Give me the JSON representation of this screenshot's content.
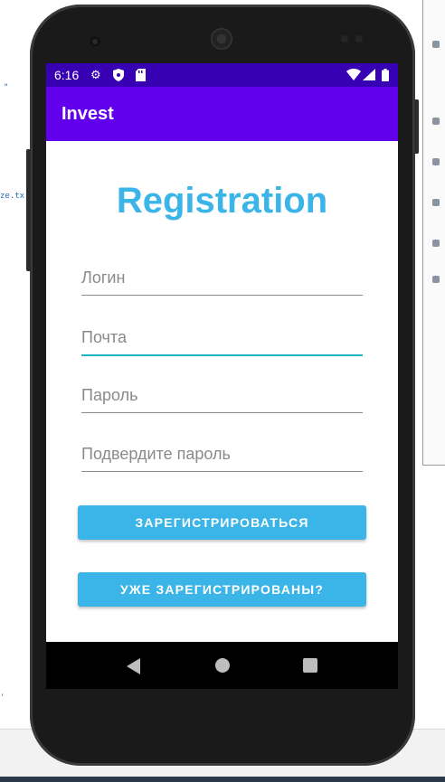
{
  "ide": {
    "snippet1": "\"",
    "snippet2": "ze.tx",
    "snippet3": "'"
  },
  "status_bar": {
    "time": "6:16",
    "icons": [
      "settings-icon",
      "shield-icon",
      "sd-card-icon",
      "wifi-icon",
      "signal-icon",
      "battery-icon"
    ]
  },
  "app_bar": {
    "title": "Invest"
  },
  "form": {
    "title": "Registration",
    "login_placeholder": "Логин",
    "email_placeholder": "Почта",
    "password_placeholder": "Пароль",
    "confirm_placeholder": "Подвердите пароль",
    "register_label": "ЗАРЕГИСТРИРОВАТЬСЯ",
    "already_label": "УЖЕ ЗАРЕГИСТРИРОВАНЫ?"
  },
  "nav": {
    "icons": [
      "back-icon",
      "home-icon",
      "recents-icon"
    ]
  },
  "colors": {
    "status_bar": "#3700b3",
    "app_bar": "#6200ee",
    "accent": "#3bb4e8",
    "active_field_underline": "#1fb4c4"
  }
}
